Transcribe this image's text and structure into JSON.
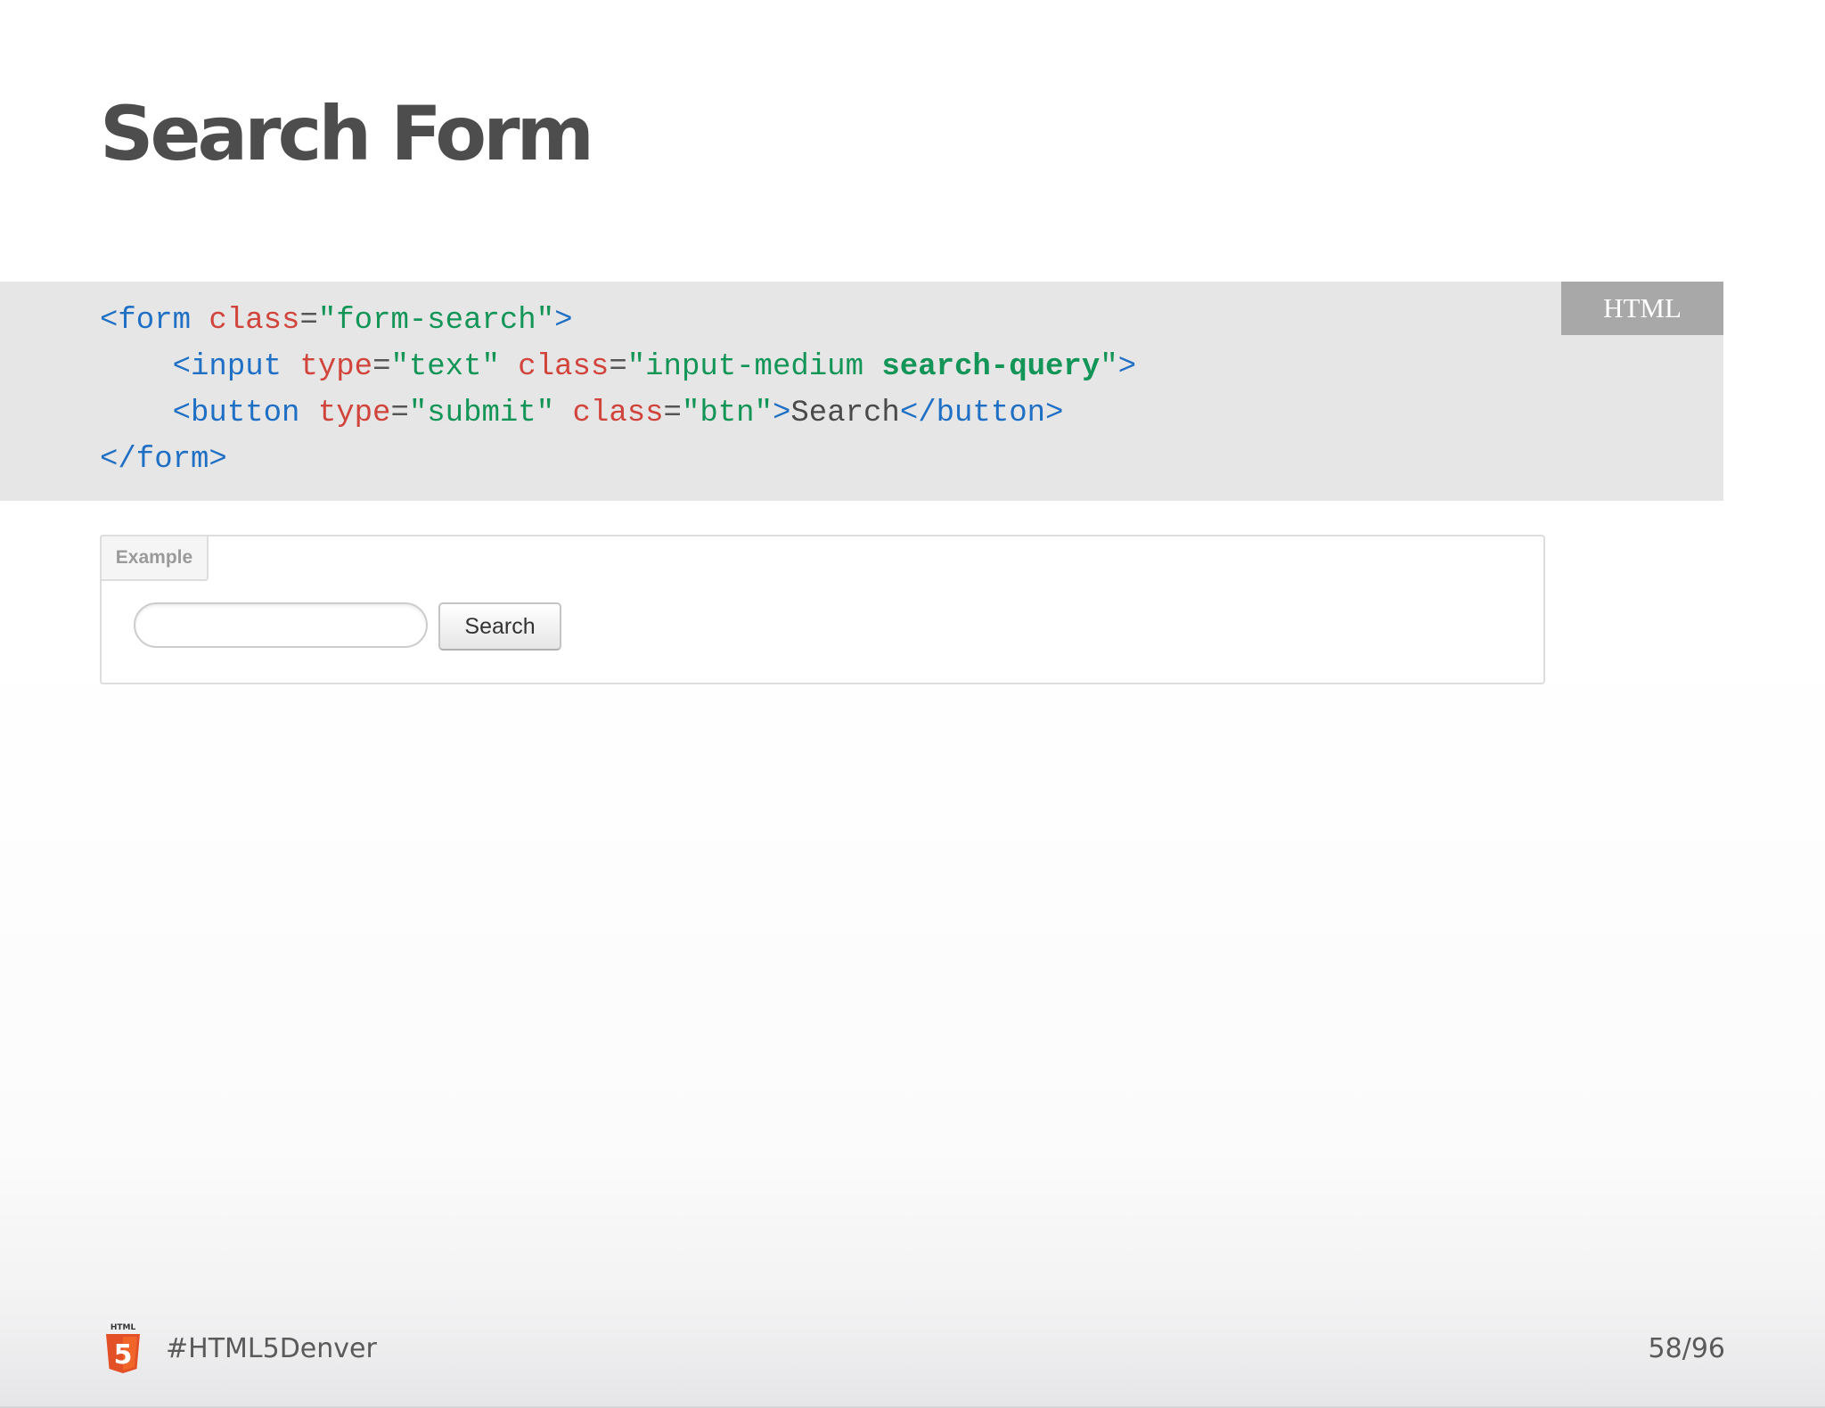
{
  "slide": {
    "title": "Search Form",
    "code_language": "HTML",
    "code_lines": [
      [
        {
          "t": "tag",
          "v": "<form "
        },
        {
          "t": "attr",
          "v": "class"
        },
        {
          "t": "eq",
          "v": "="
        },
        {
          "t": "str",
          "v": "\"form-search\""
        },
        {
          "t": "tag",
          "v": ">"
        }
      ],
      [
        {
          "t": "tag",
          "v": "    <input "
        },
        {
          "t": "attr",
          "v": "type"
        },
        {
          "t": "eq",
          "v": "="
        },
        {
          "t": "str",
          "v": "\"text\" "
        },
        {
          "t": "attr",
          "v": "class"
        },
        {
          "t": "eq",
          "v": "="
        },
        {
          "t": "str",
          "v": "\"input-medium "
        },
        {
          "t": "strong",
          "v": "search-query"
        },
        {
          "t": "str",
          "v": "\""
        },
        {
          "t": "tag",
          "v": ">"
        }
      ],
      [
        {
          "t": "tag",
          "v": "    <button "
        },
        {
          "t": "attr",
          "v": "type"
        },
        {
          "t": "eq",
          "v": "="
        },
        {
          "t": "str",
          "v": "\"submit\" "
        },
        {
          "t": "attr",
          "v": "class"
        },
        {
          "t": "eq",
          "v": "="
        },
        {
          "t": "str",
          "v": "\"btn\""
        },
        {
          "t": "tag",
          "v": ">"
        },
        {
          "t": "text",
          "v": "Search"
        },
        {
          "t": "tag",
          "v": "</button>"
        }
      ],
      [
        {
          "t": "tag",
          "v": "</form>"
        }
      ]
    ],
    "example": {
      "label": "Example",
      "search_input_value": "",
      "search_button_label": "Search"
    },
    "footer": {
      "logo_text": "HTML",
      "logo_numeral": "5",
      "hashtag": "#HTML5Denver",
      "page_number": "58/96"
    },
    "colors": {
      "title": "#4d4d4d",
      "code_background": "#e6e6e6",
      "code_tag": "#1f6fc5",
      "code_attribute": "#d1443c",
      "code_string": "#129557",
      "language_badge": "#a8a8a8",
      "html5_logo": "#e34f26"
    },
    "icons": {
      "footer_logo": "html5-logo-icon"
    }
  }
}
